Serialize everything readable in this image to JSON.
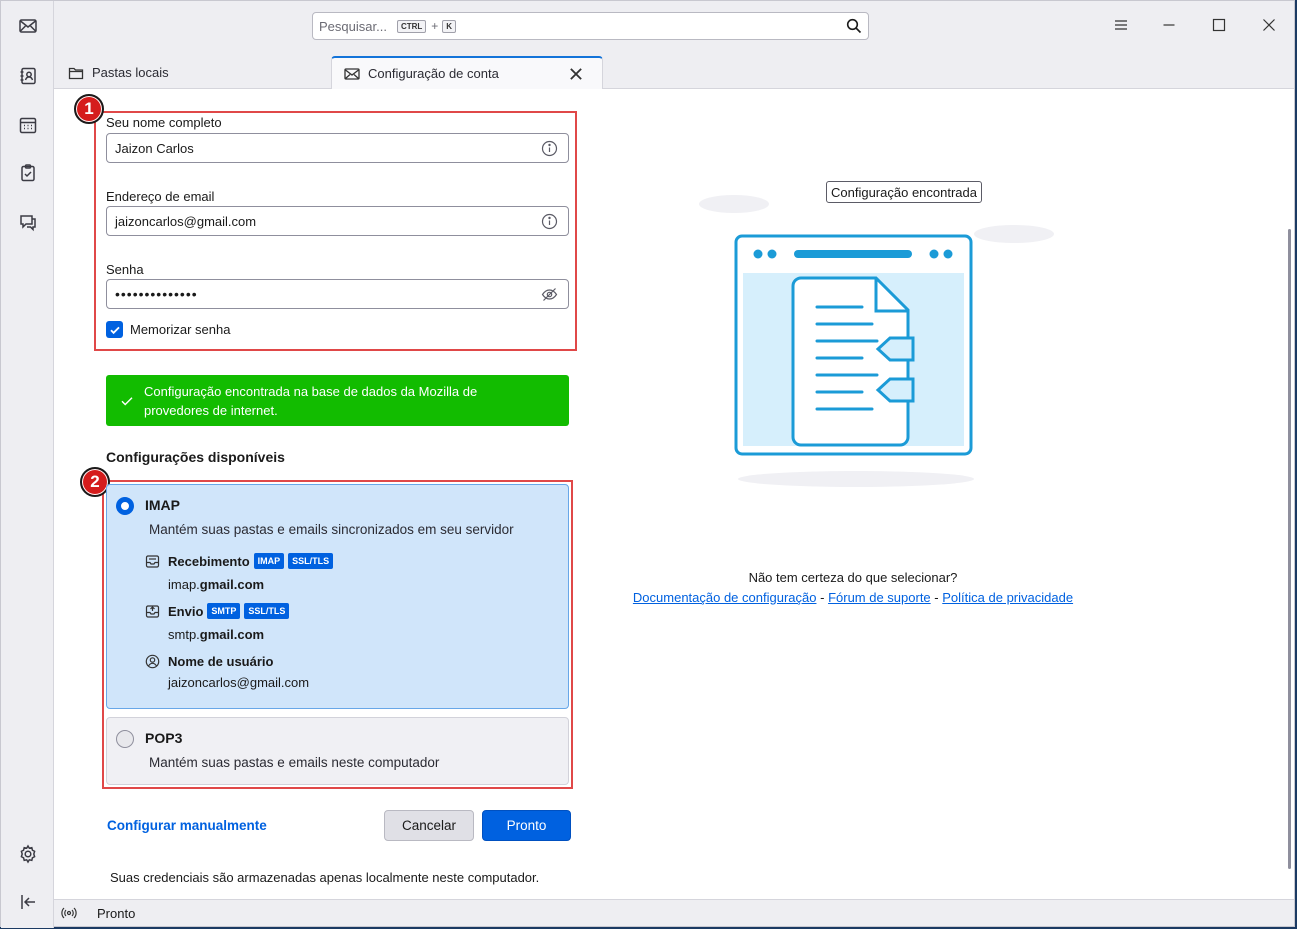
{
  "search": {
    "placeholder": "Pesquisar...",
    "key1": "CTRL",
    "plus": "+",
    "key2": "K"
  },
  "tabs": [
    {
      "label": "Pastas locais",
      "icon": "folder-icon"
    },
    {
      "label": "Configuração de conta",
      "icon": "account-setup-icon"
    }
  ],
  "form": {
    "name_label": "Seu nome completo",
    "name_value": "Jaizon Carlos",
    "email_label": "Endereço de email",
    "email_value": "jaizoncarlos@gmail.com",
    "password_label": "Senha",
    "password_value": "••••••••••••••",
    "remember_label": "Memorizar senha"
  },
  "annotations": {
    "one": "1",
    "two": "2",
    "color": "#e04848"
  },
  "success_message": "Configuração encontrada na base de dados da Mozilla de provedores de internet.",
  "configs_title": "Configurações disponíveis",
  "imap": {
    "title": "IMAP",
    "description": "Mantém suas pastas e emails sincronizados em seu servidor",
    "incoming_label": "Recebimento",
    "incoming_tags": [
      "IMAP",
      "SSL/TLS"
    ],
    "incoming_host_prefix": "imap.",
    "incoming_host_domain": "gmail.com",
    "outgoing_label": "Envio",
    "outgoing_tags": [
      "SMTP",
      "SSL/TLS"
    ],
    "outgoing_host_prefix": "smtp.",
    "outgoing_host_domain": "gmail.com",
    "username_label": "Nome de usuário",
    "username_value": "jaizoncarlos@gmail.com"
  },
  "pop3": {
    "title": "POP3",
    "description": "Mantém suas pastas e emails neste computador"
  },
  "actions": {
    "manual": "Configurar manualmente",
    "cancel": "Cancelar",
    "done": "Pronto"
  },
  "footnote": "Suas credenciais são armazenadas apenas localmente neste computador.",
  "right": {
    "found_badge": "Configuração encontrada",
    "help_question": "Não tem certeza do que selecionar?",
    "link_docs": "Documentação de configuração",
    "sep": "-",
    "link_forum": "Fórum de suporte",
    "link_privacy": "Política de privacidade"
  },
  "status": {
    "text": "Pronto"
  },
  "colors": {
    "accent": "#0061e0",
    "success": "#12bc00",
    "illustration": "#1b9bd7"
  }
}
